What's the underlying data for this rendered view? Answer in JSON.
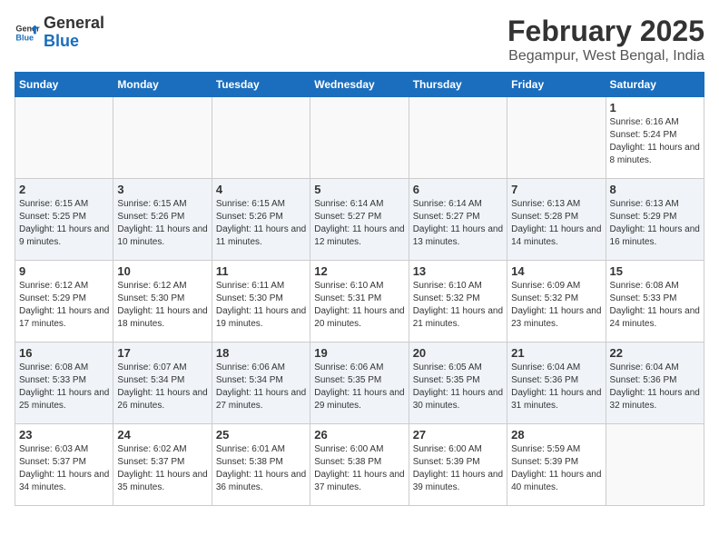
{
  "logo": {
    "text_general": "General",
    "text_blue": "Blue"
  },
  "header": {
    "title": "February 2025",
    "subtitle": "Begampur, West Bengal, India"
  },
  "days_of_week": [
    "Sunday",
    "Monday",
    "Tuesday",
    "Wednesday",
    "Thursday",
    "Friday",
    "Saturday"
  ],
  "weeks": [
    [
      {
        "day": "",
        "info": ""
      },
      {
        "day": "",
        "info": ""
      },
      {
        "day": "",
        "info": ""
      },
      {
        "day": "",
        "info": ""
      },
      {
        "day": "",
        "info": ""
      },
      {
        "day": "",
        "info": ""
      },
      {
        "day": "1",
        "info": "Sunrise: 6:16 AM\nSunset: 5:24 PM\nDaylight: 11 hours and 8 minutes."
      }
    ],
    [
      {
        "day": "2",
        "info": "Sunrise: 6:15 AM\nSunset: 5:25 PM\nDaylight: 11 hours and 9 minutes."
      },
      {
        "day": "3",
        "info": "Sunrise: 6:15 AM\nSunset: 5:26 PM\nDaylight: 11 hours and 10 minutes."
      },
      {
        "day": "4",
        "info": "Sunrise: 6:15 AM\nSunset: 5:26 PM\nDaylight: 11 hours and 11 minutes."
      },
      {
        "day": "5",
        "info": "Sunrise: 6:14 AM\nSunset: 5:27 PM\nDaylight: 11 hours and 12 minutes."
      },
      {
        "day": "6",
        "info": "Sunrise: 6:14 AM\nSunset: 5:27 PM\nDaylight: 11 hours and 13 minutes."
      },
      {
        "day": "7",
        "info": "Sunrise: 6:13 AM\nSunset: 5:28 PM\nDaylight: 11 hours and 14 minutes."
      },
      {
        "day": "8",
        "info": "Sunrise: 6:13 AM\nSunset: 5:29 PM\nDaylight: 11 hours and 16 minutes."
      }
    ],
    [
      {
        "day": "9",
        "info": "Sunrise: 6:12 AM\nSunset: 5:29 PM\nDaylight: 11 hours and 17 minutes."
      },
      {
        "day": "10",
        "info": "Sunrise: 6:12 AM\nSunset: 5:30 PM\nDaylight: 11 hours and 18 minutes."
      },
      {
        "day": "11",
        "info": "Sunrise: 6:11 AM\nSunset: 5:30 PM\nDaylight: 11 hours and 19 minutes."
      },
      {
        "day": "12",
        "info": "Sunrise: 6:10 AM\nSunset: 5:31 PM\nDaylight: 11 hours and 20 minutes."
      },
      {
        "day": "13",
        "info": "Sunrise: 6:10 AM\nSunset: 5:32 PM\nDaylight: 11 hours and 21 minutes."
      },
      {
        "day": "14",
        "info": "Sunrise: 6:09 AM\nSunset: 5:32 PM\nDaylight: 11 hours and 23 minutes."
      },
      {
        "day": "15",
        "info": "Sunrise: 6:08 AM\nSunset: 5:33 PM\nDaylight: 11 hours and 24 minutes."
      }
    ],
    [
      {
        "day": "16",
        "info": "Sunrise: 6:08 AM\nSunset: 5:33 PM\nDaylight: 11 hours and 25 minutes."
      },
      {
        "day": "17",
        "info": "Sunrise: 6:07 AM\nSunset: 5:34 PM\nDaylight: 11 hours and 26 minutes."
      },
      {
        "day": "18",
        "info": "Sunrise: 6:06 AM\nSunset: 5:34 PM\nDaylight: 11 hours and 27 minutes."
      },
      {
        "day": "19",
        "info": "Sunrise: 6:06 AM\nSunset: 5:35 PM\nDaylight: 11 hours and 29 minutes."
      },
      {
        "day": "20",
        "info": "Sunrise: 6:05 AM\nSunset: 5:35 PM\nDaylight: 11 hours and 30 minutes."
      },
      {
        "day": "21",
        "info": "Sunrise: 6:04 AM\nSunset: 5:36 PM\nDaylight: 11 hours and 31 minutes."
      },
      {
        "day": "22",
        "info": "Sunrise: 6:04 AM\nSunset: 5:36 PM\nDaylight: 11 hours and 32 minutes."
      }
    ],
    [
      {
        "day": "23",
        "info": "Sunrise: 6:03 AM\nSunset: 5:37 PM\nDaylight: 11 hours and 34 minutes."
      },
      {
        "day": "24",
        "info": "Sunrise: 6:02 AM\nSunset: 5:37 PM\nDaylight: 11 hours and 35 minutes."
      },
      {
        "day": "25",
        "info": "Sunrise: 6:01 AM\nSunset: 5:38 PM\nDaylight: 11 hours and 36 minutes."
      },
      {
        "day": "26",
        "info": "Sunrise: 6:00 AM\nSunset: 5:38 PM\nDaylight: 11 hours and 37 minutes."
      },
      {
        "day": "27",
        "info": "Sunrise: 6:00 AM\nSunset: 5:39 PM\nDaylight: 11 hours and 39 minutes."
      },
      {
        "day": "28",
        "info": "Sunrise: 5:59 AM\nSunset: 5:39 PM\nDaylight: 11 hours and 40 minutes."
      },
      {
        "day": "",
        "info": ""
      }
    ]
  ]
}
